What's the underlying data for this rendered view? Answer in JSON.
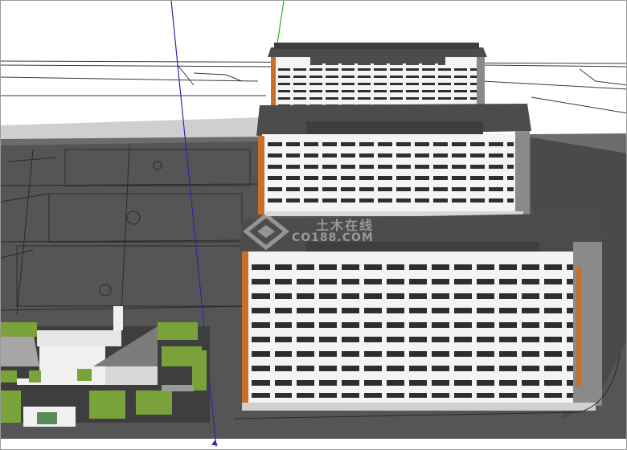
{
  "scene": {
    "description_visible": false,
    "watermark": {
      "brand": "CO188.COM",
      "brand_cn": "土木在线"
    },
    "colors": {
      "sky": "#ffffff",
      "ground_dark": "#4a4a4a",
      "ground_mid": "#5a5a5a",
      "plaza": "#525252",
      "facade": "#f4f4f4",
      "roof": "#4c4c4c",
      "window": "#2e2e2e",
      "accent_orange": "#c8702a",
      "hedge": "#7aa23a",
      "axis_blue": "#2a2aa8",
      "axis_green": "#2bb02b"
    }
  }
}
